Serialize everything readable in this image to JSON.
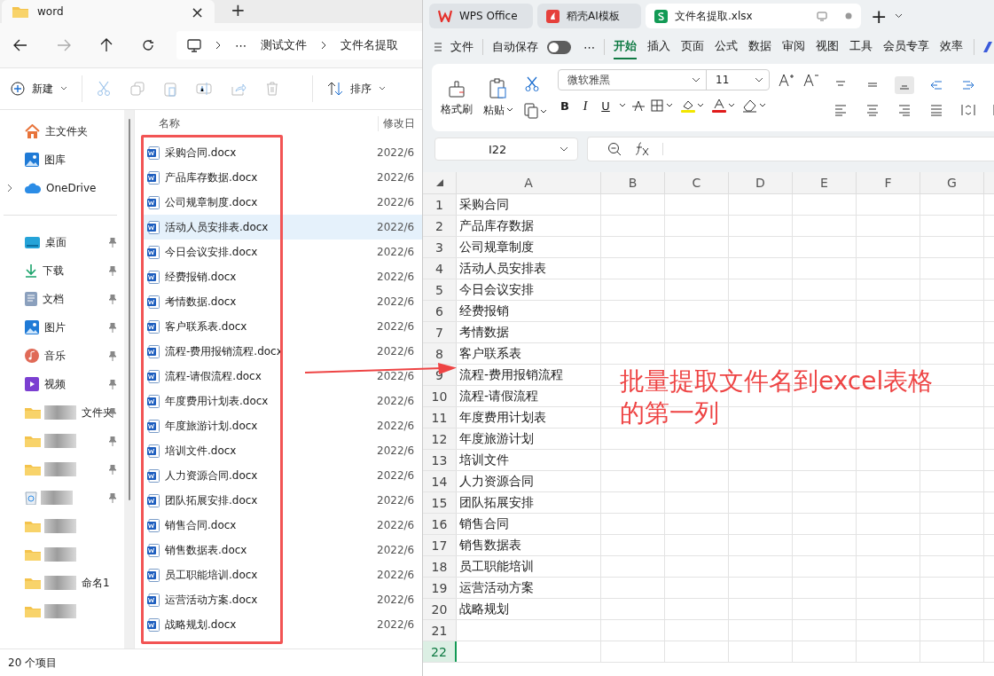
{
  "explorer": {
    "tab_title": "word",
    "close": "×",
    "new_tab": "+",
    "path": [
      "测试文件",
      "文件名提取"
    ],
    "path_more": "⋯",
    "toolbar": {
      "new": "新建",
      "sort": "排序"
    },
    "sidebar": [
      {
        "label": "主文件夹",
        "kind": "home",
        "pinned": false,
        "expandable": false,
        "blurred": false
      },
      {
        "label": "图库",
        "kind": "gallery",
        "pinned": false,
        "expandable": false,
        "blurred": false
      },
      {
        "label": "OneDrive",
        "kind": "cloud",
        "pinned": false,
        "expandable": true,
        "blurred": false
      },
      {
        "kind": "divider"
      },
      {
        "label": "桌面",
        "kind": "desktop",
        "pinned": true,
        "expandable": false,
        "blurred": false
      },
      {
        "label": "下载",
        "kind": "download",
        "pinned": true,
        "expandable": false,
        "blurred": false
      },
      {
        "label": "文档",
        "kind": "document",
        "pinned": true,
        "expandable": false,
        "blurred": false
      },
      {
        "label": "图片",
        "kind": "gallery",
        "pinned": true,
        "expandable": false,
        "blurred": false
      },
      {
        "label": "音乐",
        "kind": "music",
        "pinned": true,
        "expandable": false,
        "blurred": false
      },
      {
        "label": "视频",
        "kind": "video",
        "pinned": true,
        "expandable": false,
        "blurred": false
      },
      {
        "label": "文件夹",
        "kind": "folder",
        "pinned": true,
        "expandable": false,
        "blurred": true
      },
      {
        "kind": "folder",
        "pinned": true,
        "expandable": false,
        "blurred": true
      },
      {
        "kind": "folder",
        "pinned": true,
        "expandable": false,
        "blurred": true
      },
      {
        "kind": "recycle",
        "pinned": true,
        "expandable": false,
        "blurred": true
      },
      {
        "kind": "folder",
        "pinned": false,
        "expandable": false,
        "blurred": true
      },
      {
        "kind": "folder",
        "pinned": false,
        "expandable": false,
        "blurred": true
      },
      {
        "label": "命名1",
        "kind": "folder",
        "pinned": false,
        "expandable": false,
        "blurred": true
      },
      {
        "kind": "folder",
        "pinned": false,
        "expandable": false,
        "blurred": true
      }
    ],
    "columns": [
      "名称",
      "修改日"
    ],
    "files": [
      {
        "name": "采购合同.docx",
        "date": "2022/6",
        "selected": false
      },
      {
        "name": "产品库存数据.docx",
        "date": "2022/6",
        "selected": false
      },
      {
        "name": "公司规章制度.docx",
        "date": "2022/6",
        "selected": false
      },
      {
        "name": "活动人员安排表.docx",
        "date": "2022/6",
        "selected": true
      },
      {
        "name": "今日会议安排.docx",
        "date": "2022/6",
        "selected": false
      },
      {
        "name": "经费报销.docx",
        "date": "2022/6",
        "selected": false
      },
      {
        "name": "考情数据.docx",
        "date": "2022/6",
        "selected": false
      },
      {
        "name": "客户联系表.docx",
        "date": "2022/6",
        "selected": false
      },
      {
        "name": "流程-费用报销流程.docx",
        "date": "2022/6",
        "selected": false
      },
      {
        "name": "流程-请假流程.docx",
        "date": "2022/6",
        "selected": false
      },
      {
        "name": "年度费用计划表.docx",
        "date": "2022/6",
        "selected": false
      },
      {
        "name": "年度旅游计划.docx",
        "date": "2022/6",
        "selected": false
      },
      {
        "name": "培训文件.docx",
        "date": "2022/6",
        "selected": false
      },
      {
        "name": "人力资源合同.docx",
        "date": "2022/6",
        "selected": false
      },
      {
        "name": "团队拓展安排.docx",
        "date": "2022/6",
        "selected": false
      },
      {
        "name": "销售合同.docx",
        "date": "2022/6",
        "selected": false
      },
      {
        "name": "销售数据表.docx",
        "date": "2022/6",
        "selected": false
      },
      {
        "name": "员工职能培训.docx",
        "date": "2022/6",
        "selected": false
      },
      {
        "name": "运营活动方案.docx",
        "date": "2022/6",
        "selected": false
      },
      {
        "name": "战略规划.docx",
        "date": "2022/6",
        "selected": false
      }
    ],
    "status": "20 个项目"
  },
  "wps": {
    "tabs": [
      {
        "label": "WPS Office",
        "kind": "wps",
        "selected": false
      },
      {
        "label": "稻壳AI模板",
        "kind": "docer",
        "selected": false
      },
      {
        "label": "文件名提取.xlsx",
        "kind": "sheet",
        "selected": true
      }
    ],
    "new_tab": "+",
    "menu": {
      "file": "文件",
      "autosave": {
        "label": "自动保存",
        "on": false
      },
      "more": "⋯",
      "tabs": [
        {
          "label": "开始",
          "selected": true
        },
        {
          "label": "插入",
          "selected": false
        },
        {
          "label": "页面",
          "selected": false
        },
        {
          "label": "公式",
          "selected": false
        },
        {
          "label": "数据",
          "selected": false
        },
        {
          "label": "审阅",
          "selected": false
        },
        {
          "label": "视图",
          "selected": false
        },
        {
          "label": "工具",
          "selected": false
        },
        {
          "label": "会员专享",
          "selected": false
        },
        {
          "label": "效率",
          "selected": false
        }
      ]
    },
    "ribbon": {
      "format_painter": "格式刷",
      "paste": "粘贴",
      "font": "微软雅黑",
      "size": "11",
      "styles": [
        "B",
        "I",
        "U"
      ]
    },
    "name_box": "I22",
    "columns": [
      "A",
      "B",
      "C",
      "D",
      "E",
      "F",
      "G"
    ],
    "rows": [
      {
        "number": "1",
        "a": "采购合同",
        "selected": false
      },
      {
        "number": "2",
        "a": "产品库存数据",
        "selected": false
      },
      {
        "number": "3",
        "a": "公司规章制度",
        "selected": false
      },
      {
        "number": "4",
        "a": "活动人员安排表",
        "selected": false
      },
      {
        "number": "5",
        "a": "今日会议安排",
        "selected": false
      },
      {
        "number": "6",
        "a": "经费报销",
        "selected": false
      },
      {
        "number": "7",
        "a": "考情数据",
        "selected": false
      },
      {
        "number": "8",
        "a": "客户联系表",
        "selected": false
      },
      {
        "number": "9",
        "a": "流程-费用报销流程",
        "selected": false
      },
      {
        "number": "10",
        "a": "流程-请假流程",
        "selected": false
      },
      {
        "number": "11",
        "a": "年度费用计划表",
        "selected": false
      },
      {
        "number": "12",
        "a": "年度旅游计划",
        "selected": false
      },
      {
        "number": "13",
        "a": "培训文件",
        "selected": false
      },
      {
        "number": "14",
        "a": "人力资源合同",
        "selected": false
      },
      {
        "number": "15",
        "a": "团队拓展安排",
        "selected": false
      },
      {
        "number": "16",
        "a": "销售合同",
        "selected": false
      },
      {
        "number": "17",
        "a": "销售数据表",
        "selected": false
      },
      {
        "number": "18",
        "a": "员工职能培训",
        "selected": false
      },
      {
        "number": "19",
        "a": "运营活动方案",
        "selected": false
      },
      {
        "number": "20",
        "a": "战略规划",
        "selected": false
      },
      {
        "number": "21",
        "selected": false
      },
      {
        "number": "22",
        "selected": true
      }
    ]
  },
  "annotation": {
    "text": "批量提取文件名到excel表格的第一列"
  }
}
